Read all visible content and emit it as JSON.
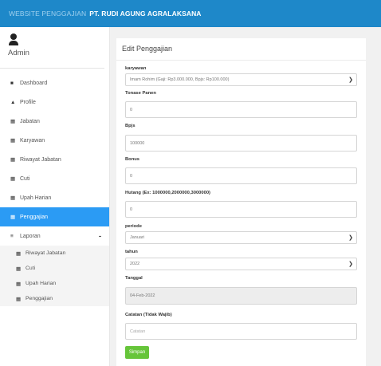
{
  "topbar": {
    "prefix": "WEBSITE PENGGAJIAN",
    "company": "PT. RUDI AGUNG AGRALAKSANA"
  },
  "sidebar": {
    "user_name": "Admin",
    "items": [
      {
        "label": "Dashboard",
        "icon": "home-icon"
      },
      {
        "label": "Profile",
        "icon": "user-icon"
      },
      {
        "label": "Jabatan",
        "icon": "table-icon"
      },
      {
        "label": "Karyawan",
        "icon": "table-icon"
      },
      {
        "label": "Riwayat Jabatan",
        "icon": "table-icon"
      },
      {
        "label": "Cuti",
        "icon": "table-icon"
      },
      {
        "label": "Upah Harian",
        "icon": "table-icon"
      },
      {
        "label": "Penggajian",
        "icon": "table-icon"
      },
      {
        "label": "Laporan",
        "icon": "bars-icon",
        "toggle": "-"
      }
    ],
    "subitems": [
      {
        "label": "Riwayat Jabatan"
      },
      {
        "label": "Cuti"
      },
      {
        "label": "Upah Harian"
      },
      {
        "label": "Penggajian"
      }
    ]
  },
  "panel": {
    "title": "Edit Penggajian",
    "fields": {
      "karyawan": {
        "label": "karyawan",
        "value": "Imam Rohim (Gaji: Rp3.000.000, Bpjs: Rp100.000)"
      },
      "tonase": {
        "label": "Tonase Panen",
        "value": "0"
      },
      "bpjs": {
        "label": "Bpjs",
        "value": "100000"
      },
      "bonus": {
        "label": "Bonus",
        "value": "0"
      },
      "hutang": {
        "label": "Hutang (Ex: 1000000,2000000,3000000)",
        "value": "0"
      },
      "periode": {
        "label": "periode",
        "value": "Januari"
      },
      "tahun": {
        "label": "tahun",
        "value": "2022"
      },
      "tanggal": {
        "label": "Tanggal",
        "value": "04-Feb-2022"
      },
      "catatan": {
        "label": "Catatan (Tidak Wajib)",
        "placeholder": "Catatan"
      }
    },
    "submit_label": "Simpan"
  },
  "colors": {
    "topbar": "#1e88c9",
    "active": "#2b9bf4",
    "submit": "#66c53a"
  }
}
